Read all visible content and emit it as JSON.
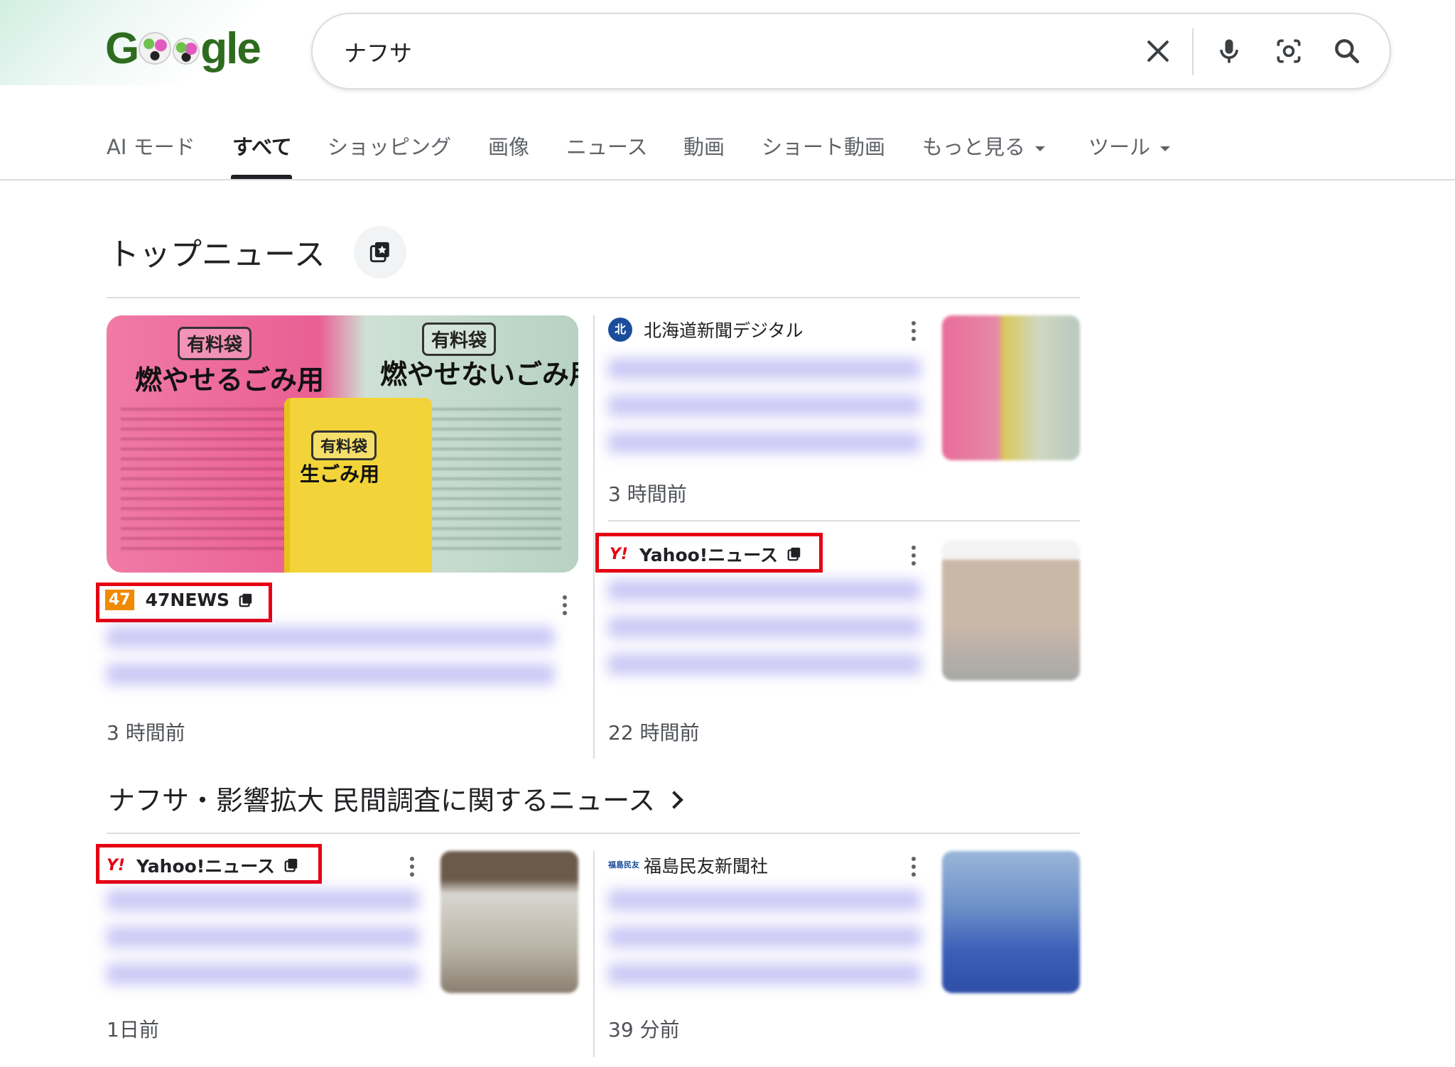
{
  "search": {
    "query": "ナフサ"
  },
  "tabs": [
    {
      "label": "AI モード"
    },
    {
      "label": "すべて"
    },
    {
      "label": "ショッピング"
    },
    {
      "label": "画像"
    },
    {
      "label": "ニュース"
    },
    {
      "label": "動画"
    },
    {
      "label": "ショート動画"
    },
    {
      "label": "もっと見る"
    },
    {
      "label": "ツール"
    }
  ],
  "top_news": {
    "title": "トップニュース",
    "thumb_texts": {
      "left_label": "有料袋",
      "left_title": "燃やせるごみ用",
      "right_label": "有料袋",
      "right_title": "燃やせないごみ用",
      "mid_label": "有料袋",
      "mid_title": "生ごみ用"
    },
    "cards": [
      {
        "source": "47NEWS",
        "logo_text": "47",
        "time": "3 時間前"
      },
      {
        "source": "北海道新聞デジタル",
        "logo_text": "北",
        "time": "3 時間前"
      },
      {
        "source": "Yahoo!ニュース",
        "logo_text": "Y!",
        "time": "22 時間前"
      }
    ]
  },
  "related": {
    "title": "ナフサ・影響拡大 民間調査に関するニュース",
    "cards": [
      {
        "source": "Yahoo!ニュース",
        "logo_text": "Y!",
        "time": "1日前"
      },
      {
        "source": "福島民友新聞社",
        "logo_text": "福島民友",
        "time": "39 分前"
      }
    ]
  },
  "colors": {
    "highlight": "#e60012",
    "accent_text": "#202124"
  }
}
